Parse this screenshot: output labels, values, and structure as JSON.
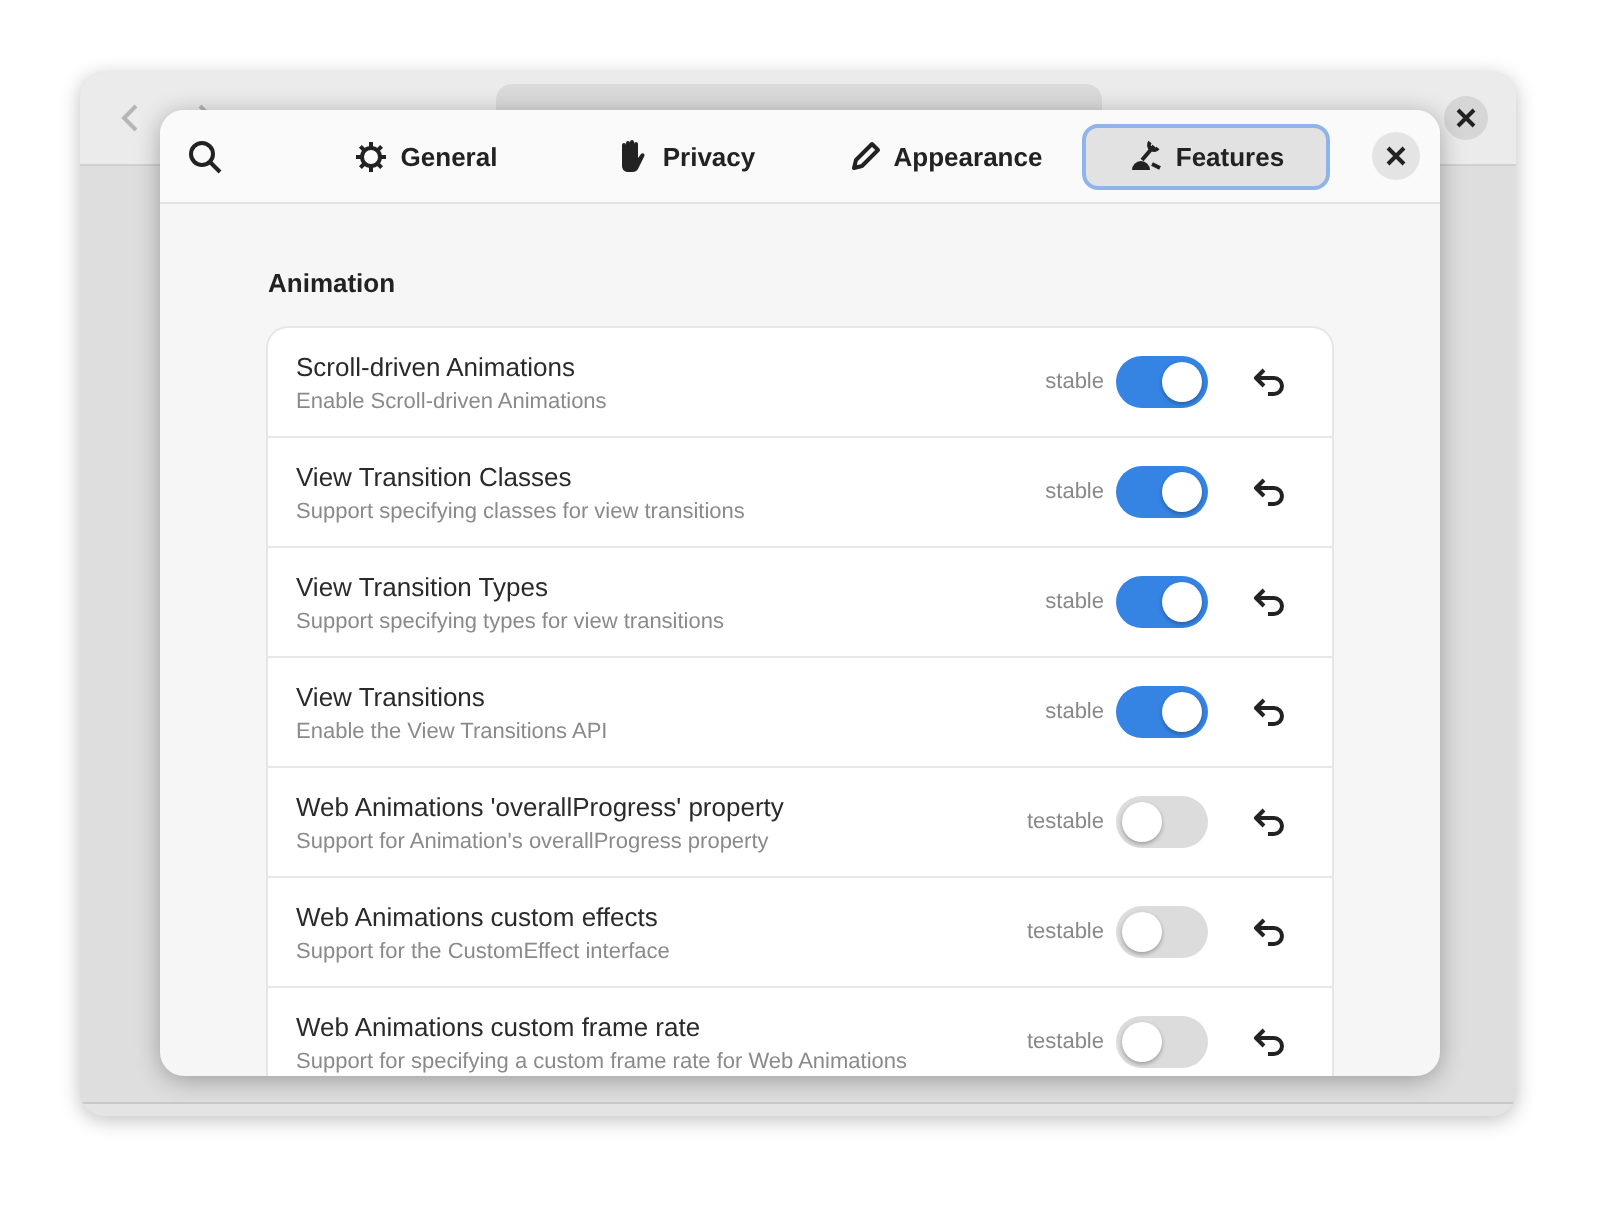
{
  "dialog": {
    "tabs": [
      {
        "label": "General",
        "selected": false
      },
      {
        "label": "Privacy",
        "selected": false
      },
      {
        "label": "Appearance",
        "selected": false
      },
      {
        "label": "Features",
        "selected": true
      }
    ],
    "section_title": "Animation",
    "features": [
      {
        "name": "Scroll-driven Animations",
        "description": "Enable Scroll-driven Animations",
        "status": "stable",
        "on": true
      },
      {
        "name": "View Transition Classes",
        "description": "Support specifying classes for view transitions",
        "status": "stable",
        "on": true
      },
      {
        "name": "View Transition Types",
        "description": "Support specifying types for view transitions",
        "status": "stable",
        "on": true
      },
      {
        "name": "View Transitions",
        "description": "Enable the View Transitions API",
        "status": "stable",
        "on": true
      },
      {
        "name": "Web Animations 'overallProgress' property",
        "description": "Support for Animation's overallProgress property",
        "status": "testable",
        "on": false
      },
      {
        "name": "Web Animations custom effects",
        "description": "Support for the CustomEffect interface",
        "status": "testable",
        "on": false
      },
      {
        "name": "Web Animations custom frame rate",
        "description": "Support for specifying a custom frame rate for Web Animations",
        "status": "testable",
        "on": false
      }
    ]
  }
}
